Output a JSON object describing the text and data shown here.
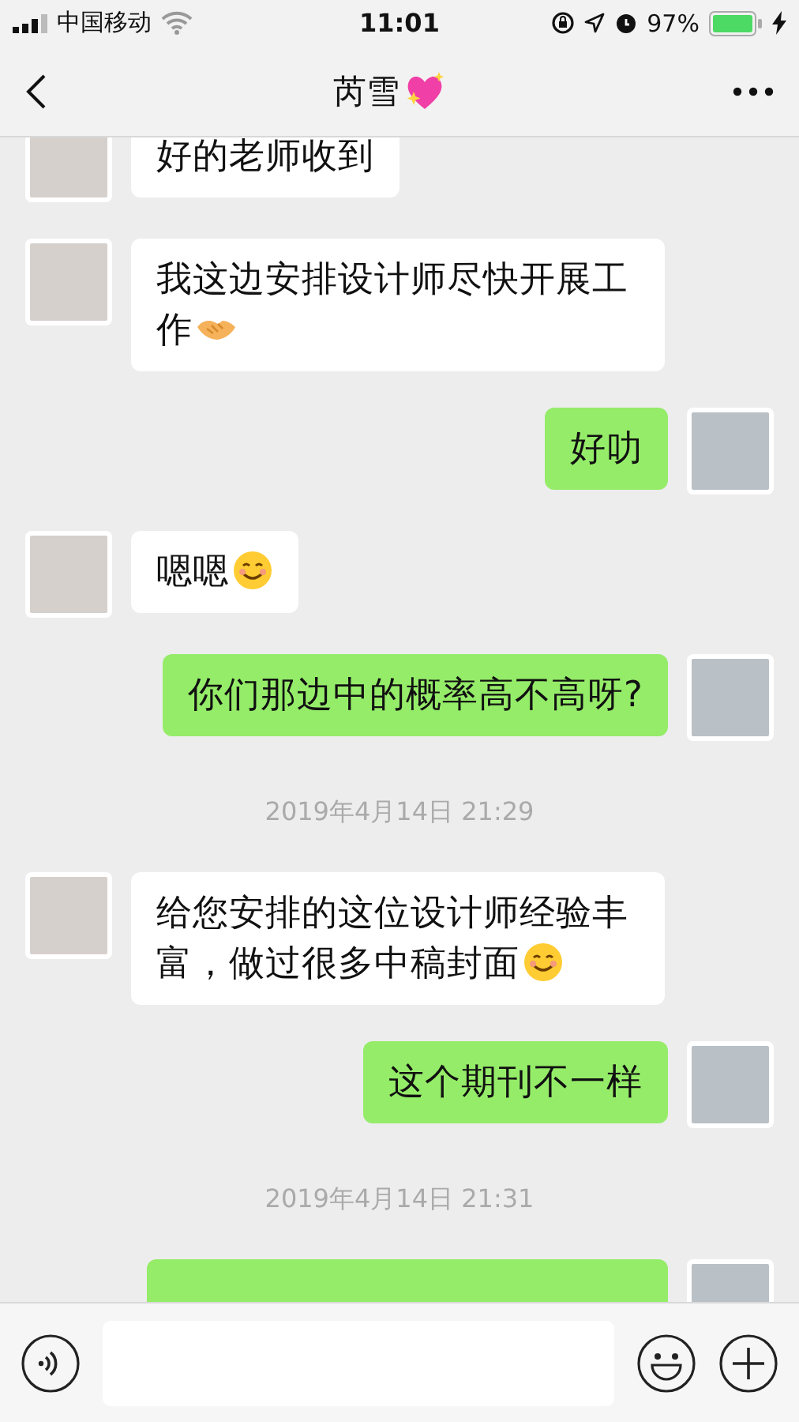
{
  "status_bar": {
    "carrier": "中国移动",
    "time": "11:01",
    "battery": "97%"
  },
  "nav": {
    "title": "芮雪"
  },
  "messages": [
    {
      "kind": "message",
      "outgoing": false,
      "text": "好的老师收到"
    },
    {
      "kind": "message",
      "outgoing": false,
      "text": "我这边安排设计师尽快开展工作",
      "emoji": {
        "kind": "handshake"
      }
    },
    {
      "kind": "message",
      "outgoing": true,
      "text": "好叻"
    },
    {
      "kind": "message",
      "outgoing": false,
      "text": "嗯嗯",
      "emoji": {
        "kind": "smile"
      }
    },
    {
      "kind": "message",
      "outgoing": true,
      "text": "你们那边中的概率高不高呀?"
    },
    {
      "kind": "timestamp",
      "text": "2019年4月14日 21:29"
    },
    {
      "kind": "message",
      "outgoing": false,
      "text": "给您安排的这位设计师经验丰富，做过很多中稿封面",
      "emoji": {
        "kind": "smile"
      }
    },
    {
      "kind": "message",
      "outgoing": true,
      "text": "这个期刊不一样"
    },
    {
      "kind": "timestamp",
      "text": "2019年4月14日 21:31"
    },
    {
      "kind": "message",
      "outgoing": true
    }
  ]
}
